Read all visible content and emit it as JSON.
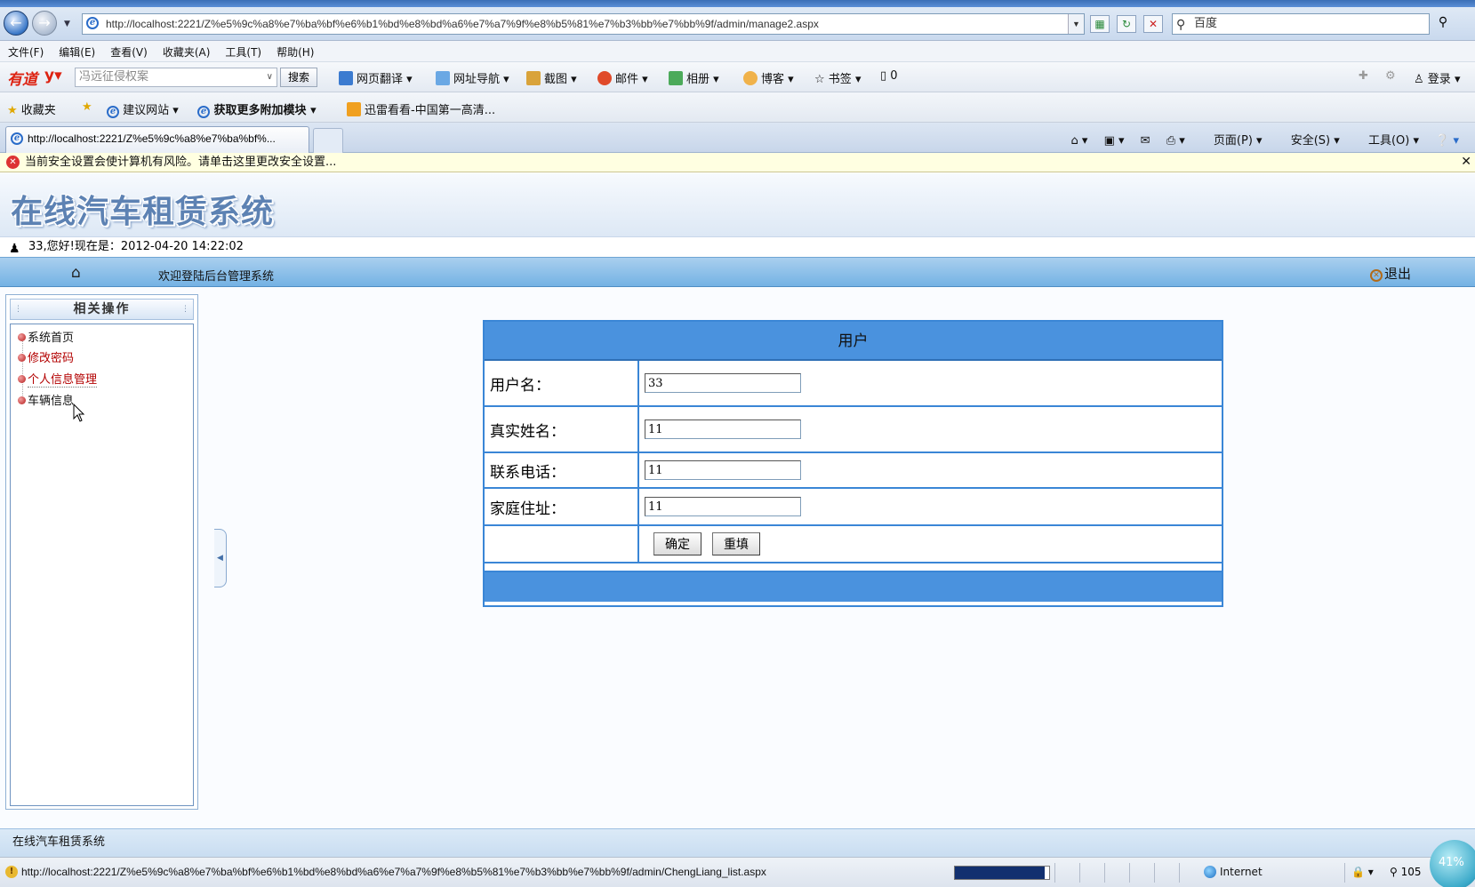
{
  "browser": {
    "url": "http://localhost:2221/Z%e5%9c%a8%e7%ba%bf%e6%b1%bd%e8%bd%a6%e7%a7%9f%e8%b5%81%e7%b3%bb%e7%bb%9f/admin/manage2.aspx",
    "search_placeholder": "百度",
    "menu": [
      "文件(F)",
      "编辑(E)",
      "查看(V)",
      "收藏夹(A)",
      "工具(T)",
      "帮助(H)"
    ],
    "toolbar": {
      "logo": "有道",
      "search_placeholder": "冯远征侵权案",
      "search_button": "搜索",
      "translate": "网页翻译",
      "nav": "网址导航",
      "screenshot": "截图",
      "mail": "邮件",
      "album": "相册",
      "blog": "博客",
      "bookmark": "书签",
      "counter": "0",
      "login": "登录"
    },
    "favorites": {
      "favorites_label": "收藏夹",
      "suggested_sites": "建议网站",
      "get_addons": "获取更多附加模块",
      "xunlei": "迅雷看看-中国第一高清..."
    },
    "tab_title": "http://localhost:2221/Z%e5%9c%a8%e7%ba%bf%...",
    "command_bar": {
      "page": "页面(P)",
      "safety": "安全(S)",
      "tools": "工具(O)"
    },
    "info_bar": "当前安全设置会使计算机有风险。请单击这里更改安全设置...",
    "status_url": "http://localhost:2221/Z%e5%9c%a8%e7%ba%bf%e6%b1%bd%e8%bd%a6%e7%a7%9f%e8%b5%81%e7%b3%bb%e7%bb%9f/admin/ChengLiang_list.aspx",
    "status_zone": "Internet",
    "status_zoom": "105",
    "network_badge": "41%",
    "load_progress": 0.95
  },
  "app": {
    "title": "在线汽车租赁系统",
    "greeting": "33,您好!现在是：2012-04-20 14:22:02",
    "welcome": "欢迎登陆后台管理系统",
    "logout": "退出",
    "footer": "在线汽车租赁系统"
  },
  "sidebar": {
    "title": "相关操作",
    "items": [
      {
        "label": "系统首页"
      },
      {
        "label": "修改密码"
      },
      {
        "label": "个人信息管理"
      },
      {
        "label": "车辆信息"
      }
    ]
  },
  "form": {
    "title": "用户",
    "fields": [
      {
        "label": "用户名：",
        "value": "33"
      },
      {
        "label": "真实姓名：",
        "value": "11"
      },
      {
        "label": "联系电话：",
        "value": "11"
      },
      {
        "label": "家庭住址：",
        "value": "11"
      }
    ],
    "submit": "确定",
    "reset": "重填"
  }
}
